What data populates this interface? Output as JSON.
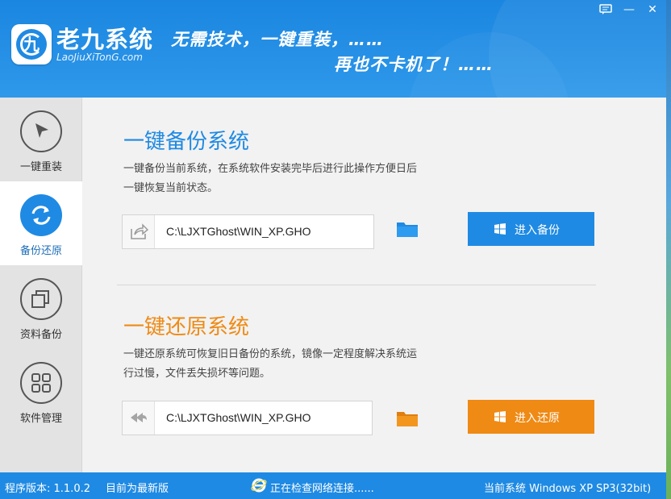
{
  "app": {
    "brand_title": "老九系统",
    "brand_sub": "LaoJiuXiTonG.com",
    "logo_letter": "九",
    "slogan_line1": "无需技术，一键重装，……",
    "slogan_line2": "再也不卡机了！……"
  },
  "window_controls": {
    "feedback": "▭",
    "minimize": "—",
    "close": "✕"
  },
  "sidebar": {
    "items": [
      {
        "label": "一键重装",
        "icon": "cursor-arrow-icon",
        "active": false
      },
      {
        "label": "备份还原",
        "icon": "sync-arrows-icon",
        "active": true
      },
      {
        "label": "资料备份",
        "icon": "copy-squares-icon",
        "active": false
      },
      {
        "label": "软件管理",
        "icon": "grid-apps-icon",
        "active": false
      }
    ]
  },
  "backup": {
    "title": "一键备份系统",
    "description": "一键备份当前系统，在系统软件安装完毕后进行此操作方便日后一键恢复当前状态。",
    "path": "C:\\LJXTGhost\\WIN_XP.GHO",
    "button_label": "进入备份"
  },
  "restore": {
    "title": "一键还原系统",
    "description": "一键还原系统可恢复旧日备份的系统，镜像一定程度解决系统运行过慢，文件丢失损坏等问题。",
    "path": "C:\\LJXTGhost\\WIN_XP.GHO",
    "button_label": "进入还原"
  },
  "status": {
    "version": "程序版本: 1.1.0.2",
    "latest": "目前为最新版",
    "network": "正在检查网络连接......",
    "system": "当前系统 Windows XP SP3(32bit)"
  },
  "colors": {
    "brand_blue": "#1f8ae3",
    "accent_orange": "#ef8a14"
  }
}
